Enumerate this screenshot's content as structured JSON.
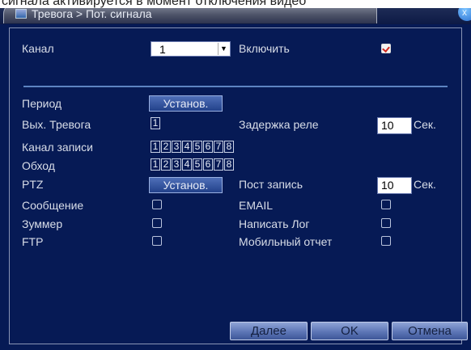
{
  "window": {
    "breadcrumb": "Тревога > Пот. сигнала",
    "close_symbol": "x",
    "top_caption": "сигнала активируется в момент отключения видео"
  },
  "form": {
    "channel": {
      "label": "Канал",
      "value": "1"
    },
    "enable": {
      "label": "Включить",
      "checked": true
    },
    "period": {
      "label": "Период",
      "button": "Установ."
    },
    "alarm_out": {
      "label": "Вых. Тревога",
      "boxes": [
        "1"
      ]
    },
    "relay_delay": {
      "label": "Задержка реле",
      "value": "10",
      "unit": "Сек."
    },
    "record_channel": {
      "label": "Канал записи",
      "boxes": [
        "1",
        "2",
        "3",
        "4",
        "5",
        "6",
        "7",
        "8"
      ]
    },
    "tour": {
      "label": "Обход",
      "boxes": [
        "1",
        "2",
        "3",
        "4",
        "5",
        "6",
        "7",
        "8"
      ]
    },
    "ptz": {
      "label": "PTZ",
      "button": "Установ."
    },
    "post_record": {
      "label": "Пост запись",
      "value": "10",
      "unit": "Сек."
    },
    "message": {
      "label": "Сообщение"
    },
    "email": {
      "label": "EMAIL"
    },
    "buzzer": {
      "label": "Зуммер"
    },
    "write_log": {
      "label": "Написать Лог"
    },
    "ftp": {
      "label": "FTP"
    },
    "mobile_report": {
      "label": "Мобильный отчет"
    }
  },
  "buttons": {
    "next": "Далее",
    "ok": "OK",
    "cancel": "Отмена"
  },
  "colors": {
    "background": "#061a55",
    "separator": "#5d84c2",
    "check_mark": "#d0281e"
  }
}
